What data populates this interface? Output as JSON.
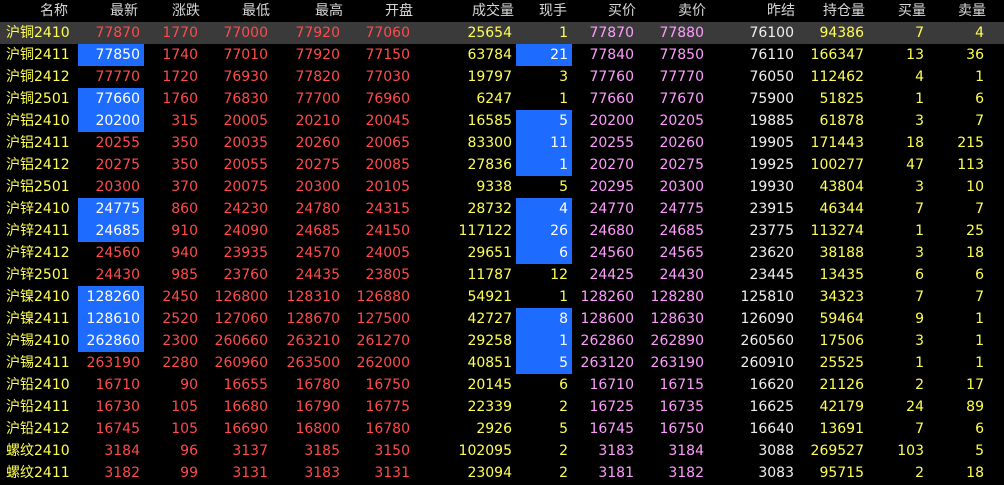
{
  "headers": {
    "name": "名称",
    "last": "最新",
    "change": "涨跌",
    "low": "最低",
    "high": "最高",
    "open": "开盘",
    "volume": "成交量",
    "curhand": "现手",
    "bid": "买价",
    "ask": "卖价",
    "prevsettle": "昨结",
    "oi": "持仓量",
    "bidvol": "买量",
    "askvol": "卖量"
  },
  "selected_row": 0,
  "rows": [
    {
      "name": "沪铜2410",
      "last": "77870",
      "change": "1770",
      "low": "77000",
      "high": "77920",
      "open": "77060",
      "volume": "25654",
      "curhand": "1",
      "bid": "77870",
      "ask": "77880",
      "prevsettle": "76100",
      "oi": "94386",
      "bidvol": "7",
      "askvol": "4",
      "hl_last": false,
      "hl_cur": false
    },
    {
      "name": "沪铜2411",
      "last": "77850",
      "change": "1740",
      "low": "77010",
      "high": "77920",
      "open": "77150",
      "volume": "63784",
      "curhand": "21",
      "bid": "77840",
      "ask": "77850",
      "prevsettle": "76110",
      "oi": "166347",
      "bidvol": "13",
      "askvol": "36",
      "hl_last": true,
      "hl_cur": true
    },
    {
      "name": "沪铜2412",
      "last": "77770",
      "change": "1720",
      "low": "76930",
      "high": "77820",
      "open": "77030",
      "volume": "19797",
      "curhand": "3",
      "bid": "77760",
      "ask": "77770",
      "prevsettle": "76050",
      "oi": "112462",
      "bidvol": "4",
      "askvol": "1",
      "hl_last": false,
      "hl_cur": false
    },
    {
      "name": "沪铜2501",
      "last": "77660",
      "change": "1760",
      "low": "76830",
      "high": "77700",
      "open": "76960",
      "volume": "6247",
      "curhand": "1",
      "bid": "77660",
      "ask": "77670",
      "prevsettle": "75900",
      "oi": "51825",
      "bidvol": "1",
      "askvol": "6",
      "hl_last": true,
      "hl_cur": false
    },
    {
      "name": "沪铝2410",
      "last": "20200",
      "change": "315",
      "low": "20005",
      "high": "20210",
      "open": "20045",
      "volume": "16585",
      "curhand": "5",
      "bid": "20200",
      "ask": "20205",
      "prevsettle": "19885",
      "oi": "61878",
      "bidvol": "3",
      "askvol": "7",
      "hl_last": true,
      "hl_cur": true
    },
    {
      "name": "沪铝2411",
      "last": "20255",
      "change": "350",
      "low": "20035",
      "high": "20260",
      "open": "20065",
      "volume": "83300",
      "curhand": "11",
      "bid": "20255",
      "ask": "20260",
      "prevsettle": "19905",
      "oi": "171443",
      "bidvol": "18",
      "askvol": "215",
      "hl_last": false,
      "hl_cur": true
    },
    {
      "name": "沪铝2412",
      "last": "20275",
      "change": "350",
      "low": "20055",
      "high": "20275",
      "open": "20085",
      "volume": "27836",
      "curhand": "1",
      "bid": "20270",
      "ask": "20275",
      "prevsettle": "19925",
      "oi": "100277",
      "bidvol": "47",
      "askvol": "113",
      "hl_last": false,
      "hl_cur": true
    },
    {
      "name": "沪铝2501",
      "last": "20300",
      "change": "370",
      "low": "20075",
      "high": "20300",
      "open": "20105",
      "volume": "9338",
      "curhand": "5",
      "bid": "20295",
      "ask": "20300",
      "prevsettle": "19930",
      "oi": "43804",
      "bidvol": "3",
      "askvol": "10",
      "hl_last": false,
      "hl_cur": false
    },
    {
      "name": "沪锌2410",
      "last": "24775",
      "change": "860",
      "low": "24230",
      "high": "24780",
      "open": "24315",
      "volume": "28732",
      "curhand": "4",
      "bid": "24770",
      "ask": "24775",
      "prevsettle": "23915",
      "oi": "46344",
      "bidvol": "7",
      "askvol": "7",
      "hl_last": true,
      "hl_cur": true
    },
    {
      "name": "沪锌2411",
      "last": "24685",
      "change": "910",
      "low": "24090",
      "high": "24685",
      "open": "24150",
      "volume": "117122",
      "curhand": "26",
      "bid": "24680",
      "ask": "24685",
      "prevsettle": "23775",
      "oi": "113274",
      "bidvol": "1",
      "askvol": "25",
      "hl_last": true,
      "hl_cur": true
    },
    {
      "name": "沪锌2412",
      "last": "24560",
      "change": "940",
      "low": "23935",
      "high": "24570",
      "open": "24005",
      "volume": "29651",
      "curhand": "6",
      "bid": "24560",
      "ask": "24565",
      "prevsettle": "23620",
      "oi": "38188",
      "bidvol": "3",
      "askvol": "18",
      "hl_last": false,
      "hl_cur": true
    },
    {
      "name": "沪锌2501",
      "last": "24430",
      "change": "985",
      "low": "23760",
      "high": "24435",
      "open": "23805",
      "volume": "11787",
      "curhand": "12",
      "bid": "24425",
      "ask": "24430",
      "prevsettle": "23445",
      "oi": "13435",
      "bidvol": "6",
      "askvol": "6",
      "hl_last": false,
      "hl_cur": false
    },
    {
      "name": "沪镍2410",
      "last": "128260",
      "change": "2450",
      "low": "126800",
      "high": "128310",
      "open": "126880",
      "volume": "54921",
      "curhand": "1",
      "bid": "128260",
      "ask": "128280",
      "prevsettle": "125810",
      "oi": "34323",
      "bidvol": "7",
      "askvol": "7",
      "hl_last": true,
      "hl_cur": false
    },
    {
      "name": "沪镍2411",
      "last": "128610",
      "change": "2520",
      "low": "127060",
      "high": "128670",
      "open": "127500",
      "volume": "42727",
      "curhand": "8",
      "bid": "128600",
      "ask": "128630",
      "prevsettle": "126090",
      "oi": "59464",
      "bidvol": "9",
      "askvol": "1",
      "hl_last": true,
      "hl_cur": true
    },
    {
      "name": "沪锡2410",
      "last": "262860",
      "change": "2300",
      "low": "260660",
      "high": "263210",
      "open": "261270",
      "volume": "29258",
      "curhand": "1",
      "bid": "262860",
      "ask": "262890",
      "prevsettle": "260560",
      "oi": "17506",
      "bidvol": "3",
      "askvol": "1",
      "hl_last": true,
      "hl_cur": true
    },
    {
      "name": "沪锡2411",
      "last": "263190",
      "change": "2280",
      "low": "260960",
      "high": "263500",
      "open": "262000",
      "volume": "40851",
      "curhand": "5",
      "bid": "263120",
      "ask": "263190",
      "prevsettle": "260910",
      "oi": "25525",
      "bidvol": "1",
      "askvol": "1",
      "hl_last": false,
      "hl_cur": true
    },
    {
      "name": "沪铅2410",
      "last": "16710",
      "change": "90",
      "low": "16655",
      "high": "16780",
      "open": "16750",
      "volume": "20145",
      "curhand": "6",
      "bid": "16710",
      "ask": "16715",
      "prevsettle": "16620",
      "oi": "21126",
      "bidvol": "2",
      "askvol": "17",
      "hl_last": false,
      "hl_cur": false
    },
    {
      "name": "沪铅2411",
      "last": "16730",
      "change": "105",
      "low": "16680",
      "high": "16790",
      "open": "16775",
      "volume": "22339",
      "curhand": "2",
      "bid": "16725",
      "ask": "16735",
      "prevsettle": "16625",
      "oi": "42179",
      "bidvol": "24",
      "askvol": "89",
      "hl_last": false,
      "hl_cur": false
    },
    {
      "name": "沪铅2412",
      "last": "16745",
      "change": "105",
      "low": "16690",
      "high": "16800",
      "open": "16780",
      "volume": "2926",
      "curhand": "5",
      "bid": "16745",
      "ask": "16750",
      "prevsettle": "16640",
      "oi": "13691",
      "bidvol": "7",
      "askvol": "6",
      "hl_last": false,
      "hl_cur": false
    },
    {
      "name": "螺纹2410",
      "last": "3184",
      "change": "96",
      "low": "3137",
      "high": "3185",
      "open": "3150",
      "volume": "102095",
      "curhand": "2",
      "bid": "3183",
      "ask": "3184",
      "prevsettle": "3088",
      "oi": "269527",
      "bidvol": "103",
      "askvol": "5",
      "hl_last": false,
      "hl_cur": false
    },
    {
      "name": "螺纹2411",
      "last": "3182",
      "change": "99",
      "low": "3131",
      "high": "3183",
      "open": "3131",
      "volume": "23094",
      "curhand": "2",
      "bid": "3181",
      "ask": "3182",
      "prevsettle": "3083",
      "oi": "95715",
      "bidvol": "2",
      "askvol": "18",
      "hl_last": false,
      "hl_cur": false
    }
  ]
}
